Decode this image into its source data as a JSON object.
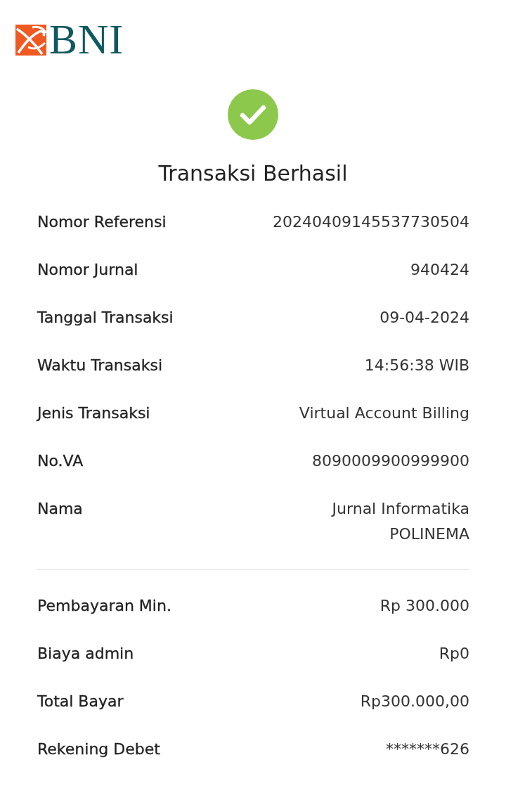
{
  "header": {
    "logo_text": "BNI"
  },
  "status": {
    "kind": "success",
    "title": "Transaksi Berhasil"
  },
  "details": [
    {
      "label": "Nomor Referensi",
      "value": "20240409145537730504"
    },
    {
      "label": "Nomor Jurnal",
      "value": "940424"
    },
    {
      "label": "Tanggal Transaksi",
      "value": "09-04-2024"
    },
    {
      "label": "Waktu Transaksi",
      "value": "14:56:38 WIB"
    },
    {
      "label": "Jenis Transaksi",
      "value": "Virtual Account Billing"
    },
    {
      "label": "No.VA",
      "value": "8090009900999900"
    },
    {
      "label": "Nama",
      "value": "Jurnal Informatika POLINEMA"
    }
  ],
  "summary": [
    {
      "label": "Pembayaran Min.",
      "value": "Rp 300.000"
    },
    {
      "label": "Biaya admin",
      "value": "Rp0"
    },
    {
      "label": "Total Bayar",
      "value": "Rp300.000,00"
    },
    {
      "label": "Rekening Debet",
      "value": "*******626"
    }
  ]
}
